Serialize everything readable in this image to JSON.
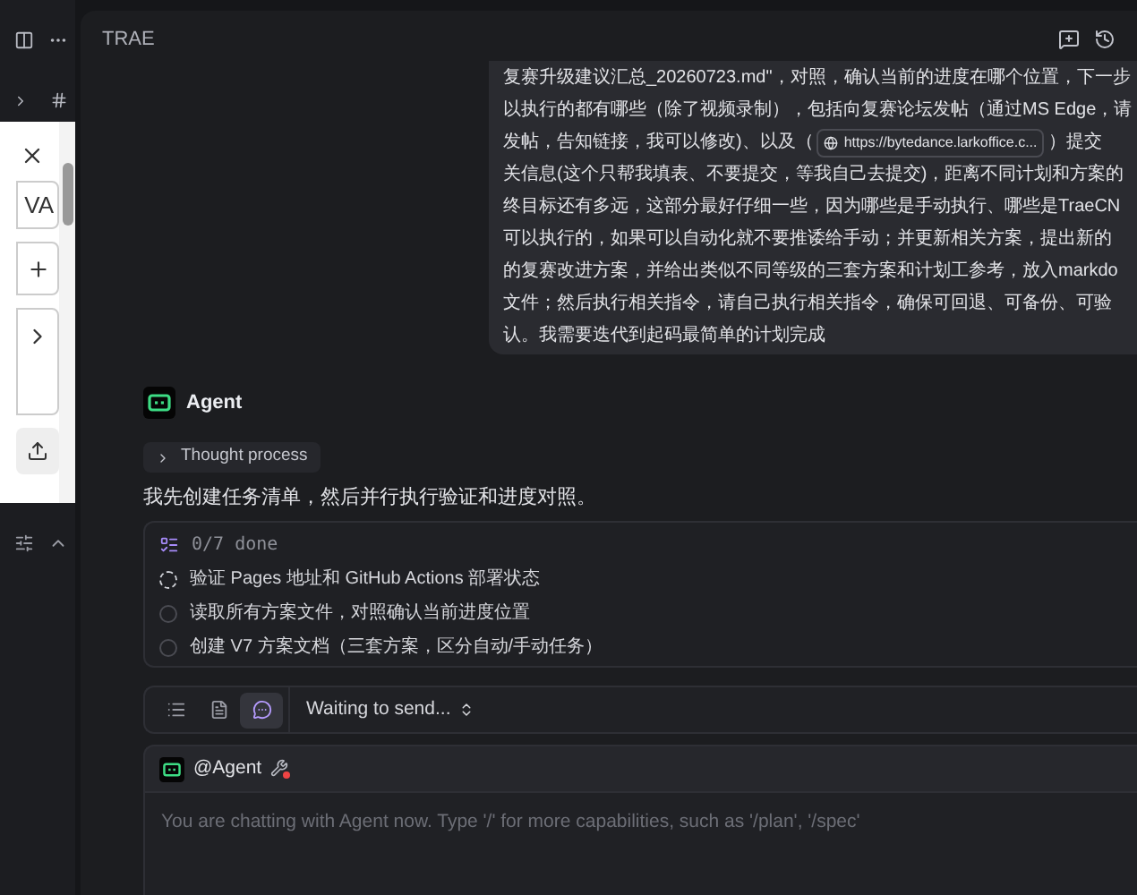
{
  "side_panel": {
    "field_value": "VA"
  },
  "header": {
    "title": "TRAE"
  },
  "user_message": {
    "lines": [
      {
        "text": "复赛升级建议汇总_20260723.md\"，对照，确认当前的进度在哪个位置，下一步"
      },
      {
        "text": "以执行的都有哪些（除了视频录制），包括向复赛论坛发帖（通过MS Edge，请"
      },
      {
        "text": "发帖，告知链接，我可以修改)、以及（",
        "link": "https://bytedance.larkoffice.c...",
        "after": "）提交"
      },
      {
        "text": "关信息(这个只帮我填表、不要提交，等我自己去提交)，距离不同计划和方案的"
      },
      {
        "text": "终目标还有多远，这部分最好仔细一些，因为哪些是手动执行、哪些是TraeCN"
      },
      {
        "text": "可以执行的，如果可以自动化就不要推诿给手动；并更新相关方案，提出新的"
      },
      {
        "text": "的复赛改进方案，并给出类似不同等级的三套方案和计划工参考，放入markdo"
      },
      {
        "text": "文件；然后执行相关指令，请自己执行相关指令，确保可回退、可备份、可验"
      },
      {
        "text": "认。我需要迭代到起码最简单的计划完成"
      }
    ]
  },
  "agent": {
    "name": "Agent",
    "thought": {
      "label": "Thought process",
      "expanded": false
    },
    "reply": "我先创建任务清单，然后并行执行验证和进度对照。"
  },
  "todo": {
    "summary": "0/7 done",
    "items": [
      {
        "text": "验证 Pages 地址和 GitHub Actions 部署状态",
        "kind": "in_progress"
      },
      {
        "text": "读取所有方案文件，对照确认当前进度位置",
        "kind": "pending"
      },
      {
        "text": "创建 V7 方案文档（三套方案，区分自动/手动任务）",
        "kind": "pending"
      }
    ]
  },
  "toolbar": {
    "tabs": [
      {
        "kind": "todo",
        "selected": false
      },
      {
        "kind": "file",
        "selected": false
      },
      {
        "kind": "chat",
        "selected": true
      }
    ],
    "status": "Waiting to send..."
  },
  "composer": {
    "mention": "@Agent",
    "placeholder": "You are chatting with Agent now. Type '/' for more capabilities, such as '/plan', '/spec'"
  }
}
